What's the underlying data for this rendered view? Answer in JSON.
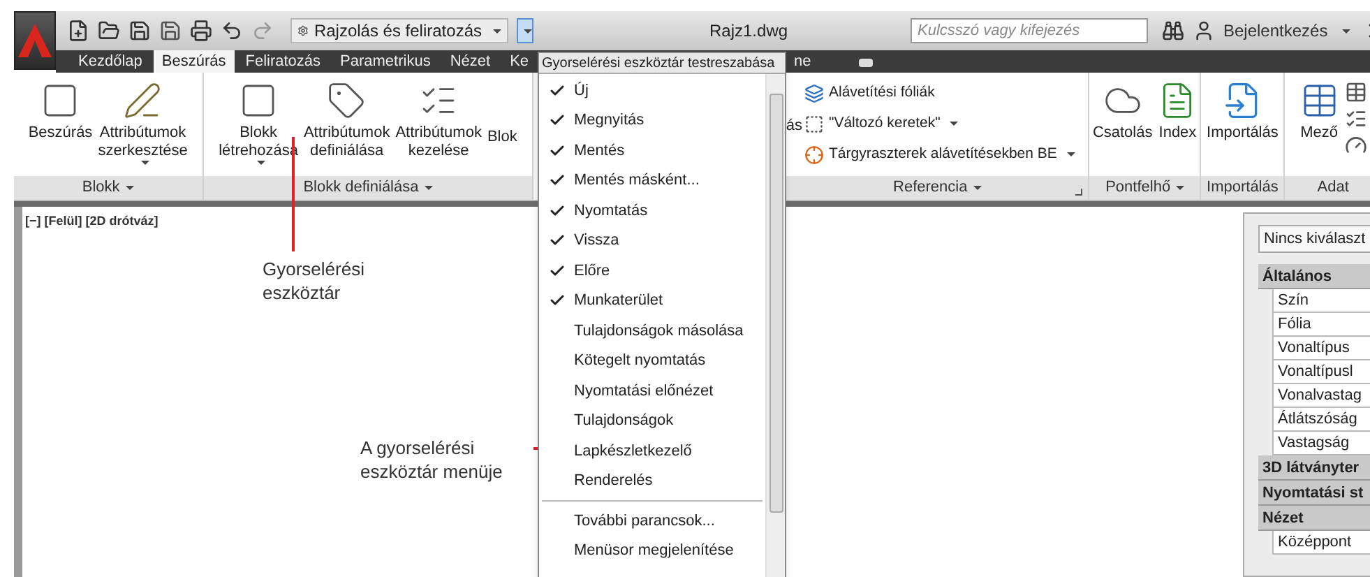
{
  "title_bar": {
    "workspace": "Rajzolás és feliratozás",
    "document": "Rajz1.dwg",
    "search": {
      "placeholder": "Kulcsszó vagy kifejezés"
    },
    "sign_in": "Bejelentkezés"
  },
  "tabs": [
    {
      "label": "Kezdőlap",
      "selected": false
    },
    {
      "label": "Beszúrás",
      "selected": true
    },
    {
      "label": "Feliratozás",
      "selected": false
    },
    {
      "label": "Parametrikus",
      "selected": false
    },
    {
      "label": "Nézet",
      "selected": false
    },
    {
      "label": "Ke",
      "selected": false
    },
    {
      "label": "ne",
      "selected": false
    }
  ],
  "ribbon": {
    "panels": [
      {
        "title": "Blokk",
        "kind": "large",
        "buttons": [
          {
            "label": "Beszúrás"
          },
          {
            "label": "Attribútumok szerkesztése",
            "dropdown": true
          }
        ]
      },
      {
        "title": "Blokk definiálása",
        "kind": "large",
        "buttons": [
          {
            "label": "Blokk létrehozása",
            "dropdown": true
          },
          {
            "label": "Attribútumok definiálása"
          },
          {
            "label": "Attribútumok kezelése"
          },
          {
            "label": "Blok"
          }
        ]
      },
      {
        "title": "Referencia",
        "kind": "list",
        "launcher": true,
        "lead": "ás",
        "items": [
          {
            "label": "Alávetítési fóliák",
            "dropdown": false
          },
          {
            "label": "\"Változó keretek\"",
            "dropdown": true
          },
          {
            "label": "Tárgyraszterek alávetítésekben BE",
            "dropdown": true
          }
        ]
      },
      {
        "title": "Pontfelhő",
        "kind": "large",
        "buttons": [
          {
            "label": "Csatolás"
          },
          {
            "label": "Index"
          }
        ]
      },
      {
        "title": "Importálás",
        "kind": "large",
        "buttons": [
          {
            "label": "Importálás"
          }
        ]
      },
      {
        "title": "Adat",
        "kind": "data",
        "buttons": [
          {
            "label": "Mező"
          }
        ]
      }
    ]
  },
  "viewport_label": "[−] [Felül] [2D drótváz]",
  "menu": {
    "title": "Gyorselérési eszköztár testreszabása",
    "options": [
      {
        "label": "Új",
        "checked": true
      },
      {
        "label": "Megnyitás",
        "checked": true
      },
      {
        "label": "Mentés",
        "checked": true
      },
      {
        "label": "Mentés másként...",
        "checked": true
      },
      {
        "label": "Nyomtatás",
        "checked": true
      },
      {
        "label": "Vissza",
        "checked": true
      },
      {
        "label": "Előre",
        "checked": true
      },
      {
        "label": "Munkaterület",
        "checked": true
      },
      {
        "label": "Tulajdonságok másolása",
        "checked": false
      },
      {
        "label": "Kötegelt nyomtatás",
        "checked": false
      },
      {
        "label": "Nyomtatási előnézet",
        "checked": false
      },
      {
        "label": "Tulajdonságok",
        "checked": false
      },
      {
        "label": "Lapkészletkezelő",
        "checked": false
      },
      {
        "label": "Renderelés",
        "checked": false
      }
    ],
    "commands": [
      "További parancsok...",
      "Menüsor megjelenítése"
    ]
  },
  "properties": {
    "selection": "Nincs kiválaszt",
    "sections": [
      {
        "title": "Általános",
        "rows": [
          "Szín",
          "Fólia",
          "Vonaltípus",
          "Vonaltípusl",
          "Vonalvastag",
          "Átlátszóság",
          "Vastagság"
        ]
      },
      {
        "title": "3D látványter"
      },
      {
        "title": "Nyomtatási st"
      },
      {
        "title": "Nézet",
        "rows": [
          "Középpont"
        ]
      }
    ]
  },
  "callouts": [
    {
      "text": "Gyorselérési eszköztár",
      "kind": "vertical"
    },
    {
      "text": "A gyorselérési eszköztár menüje",
      "kind": "horizontal"
    }
  ]
}
